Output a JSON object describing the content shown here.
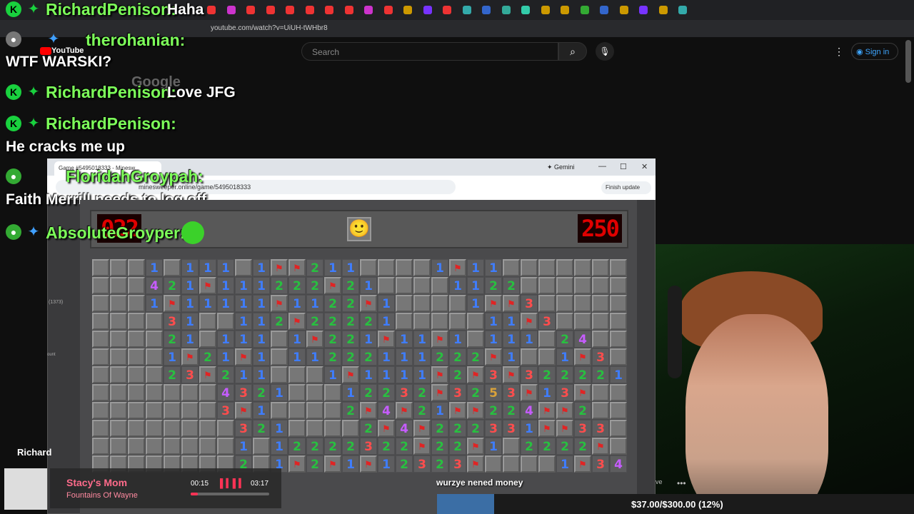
{
  "browser": {
    "url": "youtube.com/watch?v=UiUH-tWHbr8"
  },
  "youtube": {
    "logo_text": "YouTube",
    "search_placeholder": "Search",
    "signin_label": "Sign in"
  },
  "overlay": {
    "watermark": "Google"
  },
  "chat": [
    {
      "user": "RichardPenison:",
      "text": "Haha"
    },
    {
      "user": "therohanian:",
      "text": "WTF WARSKI?"
    },
    {
      "user": "RichardPenison:",
      "text": "Love JFG"
    },
    {
      "user": "RichardPenison:",
      "text": "He cracks me up"
    },
    {
      "user": "FloridahGroypah:",
      "text": "Faith Merrill needs to log off"
    },
    {
      "user": "AbsoluteGroyper:",
      "text": ""
    }
  ],
  "inner_browser": {
    "tab_title": "Game #5495018333 - Minesw...",
    "url": "minesweeper.online/game/5495018333",
    "gemini_label": "Gemini",
    "finish_update_label": "Finish update"
  },
  "game": {
    "mines_left": "022",
    "timer": "250",
    "smiley": "🙂",
    "board_rows": [
      "...1.111.1FF211....1F11.....",
      "...421F111222F21....1122....",
      "...1F11111F1122F1....1FF3...",
      "....31..112F22221.....11F3..",
      "....21.111.1F221F11F1.111.24",
      "....1F21F1.11222111222F1..1F3",
      "....23F211...1F1111F2F3F322221",
      ".......4321...12232F3253F13F",
      ".......3F1....2F4F21FF224FF2",
      "........321....2F4F222331FF33",
      "........1.12222322F22F1.2222F",
      "........2.1F2F1F12323F....1F34F"
    ]
  },
  "sidebar_labels": {
    "count": "(1373)",
    "left_label": "ount",
    "channel": "Richard"
  },
  "now_playing": {
    "song": "Stacy's Mom",
    "artist": "Fountains Of Wayne",
    "elapsed": "00:15",
    "duration": "03:17"
  },
  "caption_text": "wurzye nened money",
  "goal": {
    "text": "$37.00/$300.00 (12%)",
    "fraction": 0.12
  },
  "misc": {
    "side_end": "ve",
    "side_dots": "•••"
  },
  "colors": {
    "chat_user": "#7dff5a",
    "counter_red": "#e00000",
    "song_pink": "#ff6b8b",
    "goal_fill": "#3b6ea5"
  },
  "icons": [
    "badge-k-icon",
    "sparkle-icon",
    "search-icon",
    "mic-icon",
    "account-icon",
    "kebab-icon",
    "smiley-icon",
    "flag-icon",
    "close-icon",
    "minimize-icon",
    "maximize-icon",
    "equalizer-icon",
    "star-icon"
  ]
}
